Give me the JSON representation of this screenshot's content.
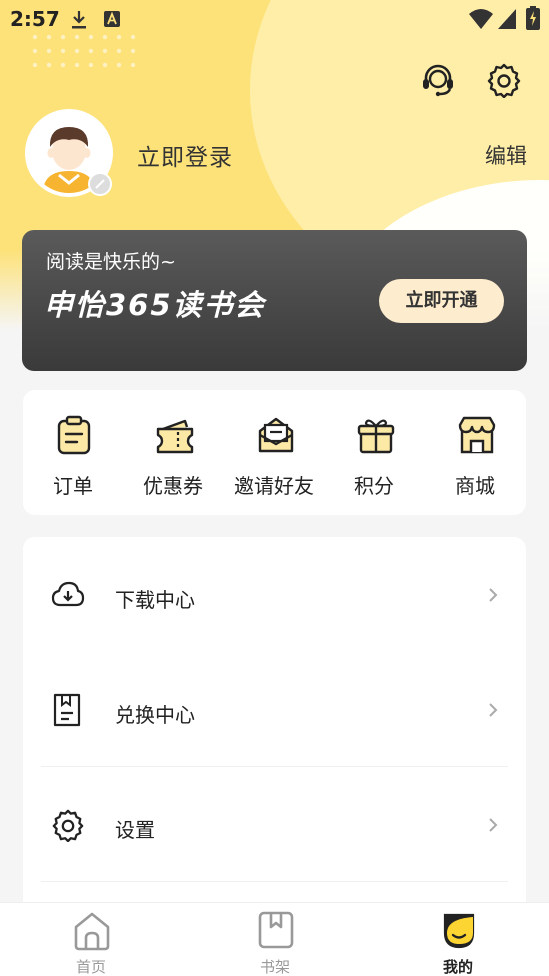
{
  "status_bar": {
    "time": "2:57",
    "icons": [
      "download-icon",
      "a-notification-icon",
      "wifi-icon",
      "signal-icon",
      "battery-charging-icon"
    ]
  },
  "header": {
    "icons": [
      "headset-icon",
      "gear-icon"
    ]
  },
  "profile": {
    "login_text": "立即登录",
    "edit_label": "编辑",
    "avatar": "avatar"
  },
  "vip_card": {
    "slogan": "阅读是快乐的~",
    "title": "申怡365读书会",
    "button_label": "立即开通"
  },
  "quick_actions": [
    {
      "label": "订单",
      "icon": "clipboard-icon"
    },
    {
      "label": "优惠券",
      "icon": "ticket-icon"
    },
    {
      "label": "邀请好友",
      "icon": "envelope-icon"
    },
    {
      "label": "积分",
      "icon": "gift-icon"
    },
    {
      "label": "商城",
      "icon": "store-icon"
    }
  ],
  "menu": [
    {
      "label": "下载中心",
      "icon": "cloud-download-icon"
    },
    {
      "label": "兑换中心",
      "icon": "redeem-icon"
    },
    {
      "label": "设置",
      "icon": "gear-icon"
    }
  ],
  "bottom_nav": [
    {
      "label": "首页",
      "icon": "home-icon",
      "active": false
    },
    {
      "label": "书架",
      "icon": "bookmark-book-icon",
      "active": false
    },
    {
      "label": "我的",
      "icon": "smiley-face-icon",
      "active": true
    }
  ],
  "colors": {
    "brand_yellow": "#fde27a",
    "vip_dark": "#4a4a4a",
    "vip_button": "#fdeccd",
    "icon_accent": "#fce9a6"
  }
}
